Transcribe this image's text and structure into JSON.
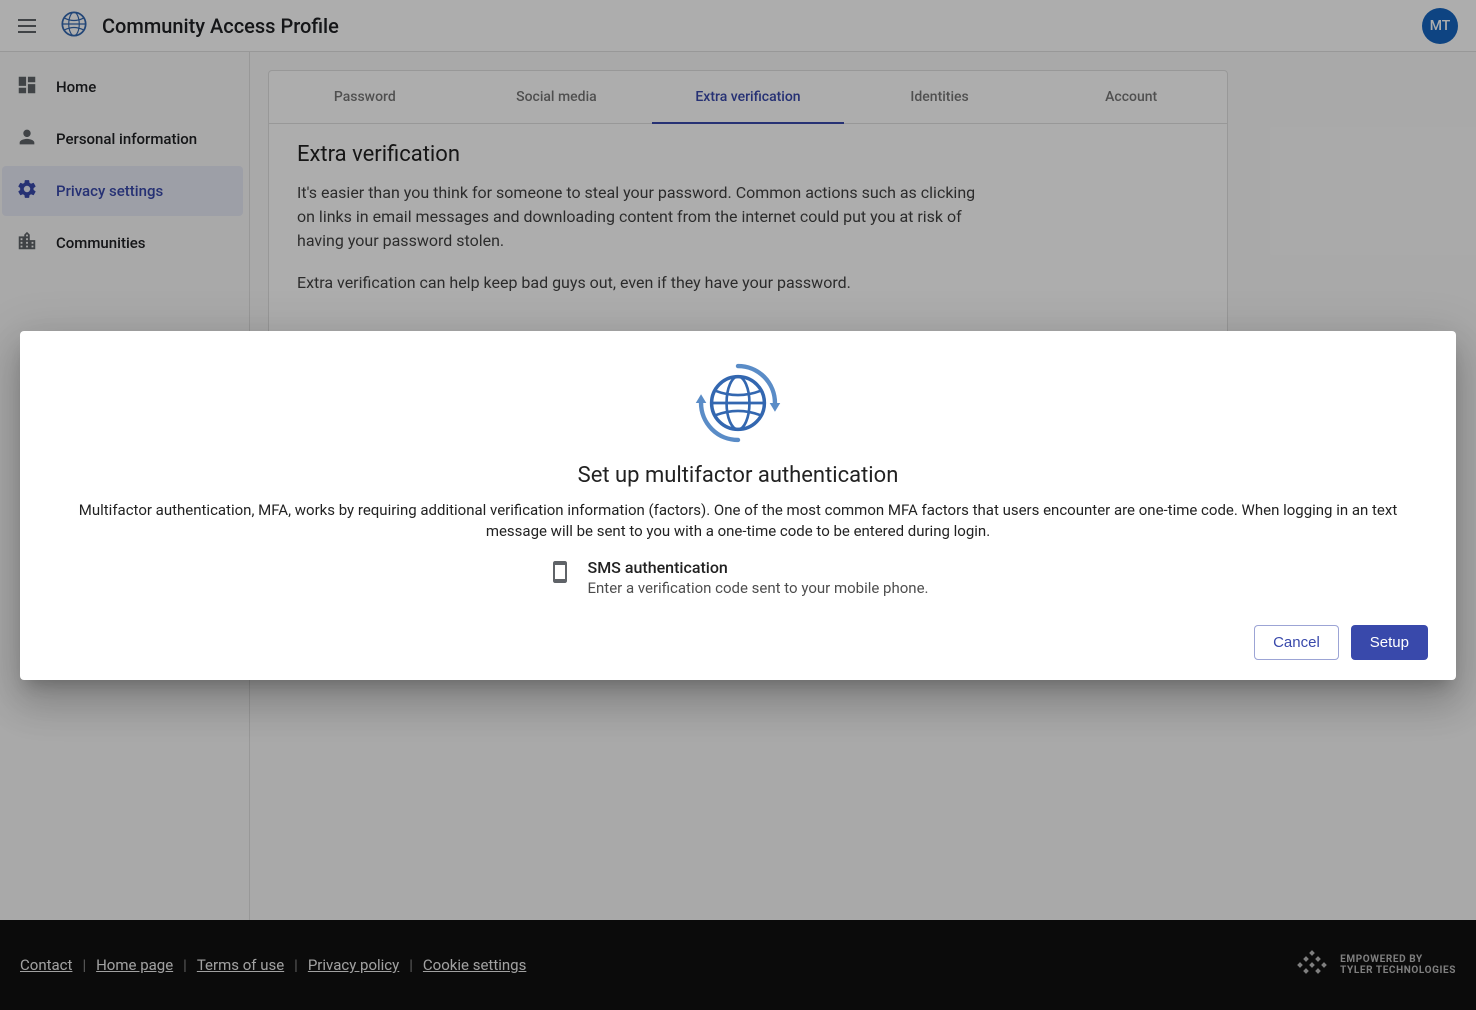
{
  "header": {
    "title": "Community Access Profile",
    "avatar_initials": "MT"
  },
  "sidebar": {
    "items": [
      {
        "label": "Home"
      },
      {
        "label": "Personal information"
      },
      {
        "label": "Privacy settings"
      },
      {
        "label": "Communities"
      }
    ]
  },
  "tabs": [
    {
      "label": "Password"
    },
    {
      "label": "Social media"
    },
    {
      "label": "Extra verification"
    },
    {
      "label": "Identities"
    },
    {
      "label": "Account"
    }
  ],
  "panel": {
    "title": "Extra verification",
    "p1": "It's easier than you think for someone to steal your password. Common actions such as clicking on links in email messages and downloading content from the internet could put you at risk of having your password stolen.",
    "p2": "Extra verification can help keep bad guys out, even if they have your password."
  },
  "dialog": {
    "title": "Set up multifactor authentication",
    "description": "Multifactor authentication, MFA, works by requiring additional verification information (factors). One of the most common MFA factors that users encounter are one-time code. When logging in an text message will be sent to you with a one-time code to be entered during login.",
    "factor_title": "SMS authentication",
    "factor_desc": "Enter a verification code sent to your mobile phone.",
    "cancel_label": "Cancel",
    "setup_label": "Setup"
  },
  "footer": {
    "links": [
      "Contact",
      "Home page",
      "Terms of use",
      "Privacy policy",
      "Cookie settings"
    ],
    "brand_line1": "EMPOWERED BY",
    "brand_line2": "TYLER TECHNOLOGIES"
  }
}
